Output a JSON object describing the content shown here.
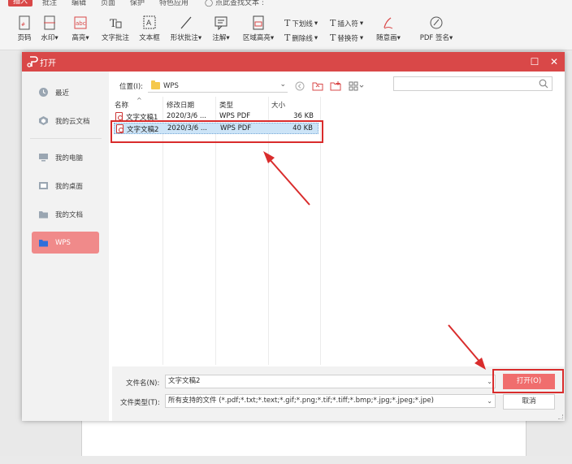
{
  "colors": {
    "accent": "#d94848",
    "primary_button": "#f06d6d",
    "active_nav": "#f08a8a",
    "selection": "#cce4f7",
    "annotation": "#d92c2c"
  },
  "menubar": {
    "items": [
      "插入",
      "批注",
      "编辑",
      "页面",
      "保护",
      "特色应用"
    ],
    "search_placeholder": "点此查找文本"
  },
  "ribbon": {
    "tools": [
      {
        "label": "页码",
        "icon": "page-number-icon"
      },
      {
        "label": "水印",
        "icon": "watermark-icon"
      },
      {
        "label": "高亮",
        "icon": "highlight-icon"
      },
      {
        "label": "文字批注",
        "icon": "text-comment-icon"
      },
      {
        "label": "文本框",
        "icon": "textbox-icon"
      },
      {
        "label": "形状批注",
        "icon": "shape-comment-icon"
      },
      {
        "label": "注解",
        "icon": "annotation-icon"
      },
      {
        "label": "区域高亮",
        "icon": "area-highlight-icon"
      }
    ],
    "small_tools": [
      {
        "label": "下划线",
        "icon": "underline-icon"
      },
      {
        "label": "插入符",
        "icon": "insert-caret-icon"
      },
      {
        "label": "删除线",
        "icon": "strikethrough-icon"
      },
      {
        "label": "替换符",
        "icon": "replace-icon"
      }
    ],
    "sign_tools": [
      {
        "label": "随意画",
        "icon": "freehand-icon"
      },
      {
        "label": "PDF 签名",
        "icon": "pdf-sign-icon"
      }
    ]
  },
  "dialog": {
    "title": "打开",
    "sidebar": [
      {
        "label": "最近",
        "icon": "clock-icon"
      },
      {
        "label": "我的云文档",
        "icon": "cloud-icon"
      },
      {
        "label": "我的电脑",
        "icon": "computer-icon"
      },
      {
        "label": "我的桌面",
        "icon": "desktop-icon"
      },
      {
        "label": "我的文档",
        "icon": "folder-icon"
      },
      {
        "label": "WPS",
        "icon": "folder-icon",
        "active": true
      }
    ],
    "location_label": "位置(I):",
    "location_value": "WPS",
    "columns": [
      "名称",
      "修改日期",
      "类型",
      "大小"
    ],
    "files": [
      {
        "name": "文字文稿1",
        "date": "2020/3/6 ...",
        "type": "WPS PDF",
        "size": "36 KB",
        "selected": false
      },
      {
        "name": "文字文稿2",
        "date": "2020/3/6 ...",
        "type": "WPS PDF",
        "size": "40 KB",
        "selected": true
      }
    ],
    "filename_label": "文件名(N):",
    "filename_value": "文字文稿2",
    "filetype_label": "文件类型(T):",
    "filetype_value": "所有支持的文件 (*.pdf;*.txt;*.text;*.gif;*.png;*.tif;*.tiff;*.bmp;*.jpg;*.jpeg;*.jpe)",
    "open_button": "打开(O)",
    "cancel_button": "取消"
  }
}
